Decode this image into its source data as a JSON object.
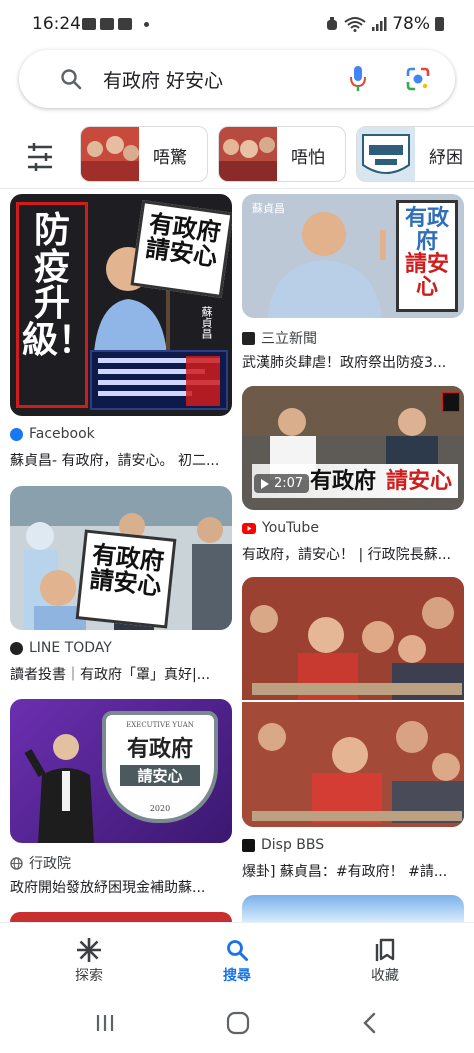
{
  "status_bar": {
    "time": "16:24",
    "battery": "78%"
  },
  "search": {
    "query": "有政府 好安心"
  },
  "chips": [
    {
      "label": "唔驚"
    },
    {
      "label": "唔怕"
    },
    {
      "label": "紓困"
    }
  ],
  "results": {
    "left": [
      {
        "source": "Facebook",
        "title": "蘇貞昌- 有政府，請安心。 初二...",
        "sign_line1": "有政府",
        "sign_line2": "請安心",
        "side_text": "防疫升級！",
        "name_tag": "蘇貞昌"
      },
      {
        "source": "LINE TODAY",
        "title": "讀者投書｜有政府「罩」真好|...",
        "sign_line1": "有政府",
        "sign_line2": "請安心"
      },
      {
        "source": "行政院",
        "title": "政府開始發放紓困現金補助蘇...",
        "badge_top": "EXECUTIVE YUAN",
        "badge_line1": "有政府",
        "badge_line2": "請安心",
        "badge_year": "2020"
      }
    ],
    "right": [
      {
        "source": "三立新聞",
        "title": "武漢肺炎肆虐！政府祭出防疫3...",
        "name_tag": "蘇貞昌",
        "sign_line1": "有政府",
        "sign_line2": "請安心"
      },
      {
        "source": "YouTube",
        "title": "有政府，請安心！ | 行政院長蘇...",
        "duration": "2:07",
        "banner_black": "有政府",
        "banner_red": "請安心"
      },
      {
        "source": "Disp BBS",
        "title": "爆卦] 蘇貞昌：#有政府！ #請..."
      }
    ]
  },
  "bottom_nav": [
    {
      "label": "探索",
      "icon": "asterisk-icon"
    },
    {
      "label": "搜尋",
      "icon": "search-icon",
      "active": true
    },
    {
      "label": "收藏",
      "icon": "bookmark-icon"
    }
  ],
  "colors": {
    "accent": "#1a73e8",
    "sign_red": "#d01c1c"
  }
}
